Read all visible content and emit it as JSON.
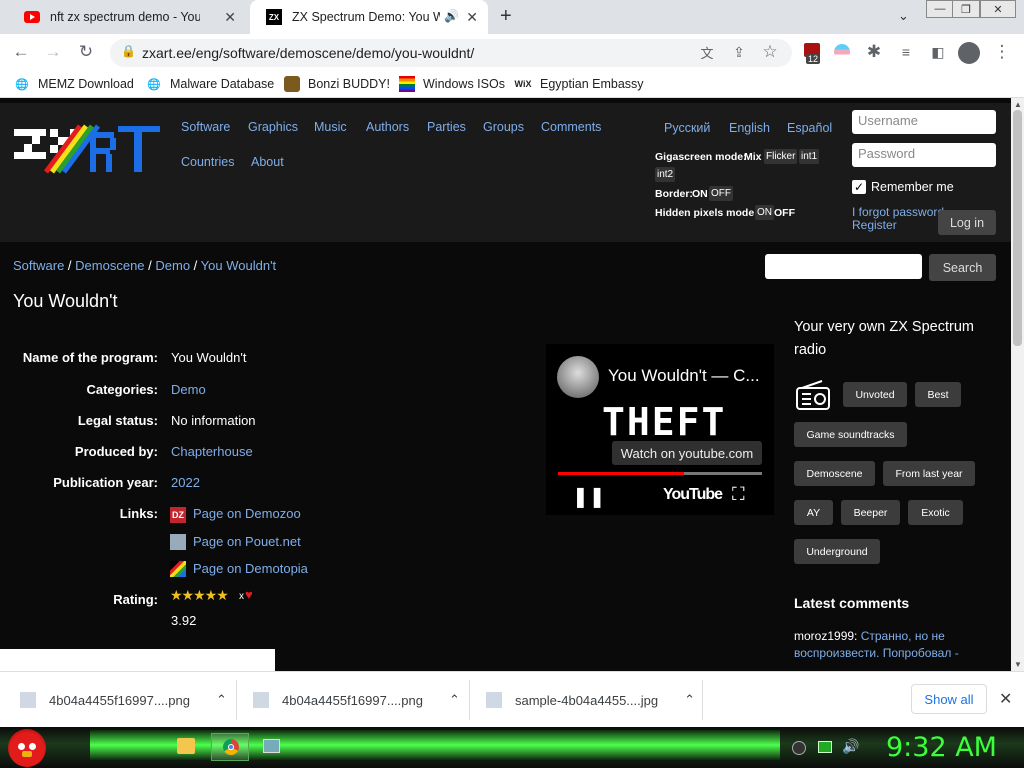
{
  "browser": {
    "tabs": [
      {
        "title": "nft zx spectrum demo - YouTube"
      },
      {
        "title": "ZX Spectrum Demo: You Wo"
      }
    ],
    "url": "zxart.ee/eng/software/demoscene/demo/you-wouldnt/",
    "ext_badge": "12",
    "bookmarks": [
      "MEMZ Download",
      "Malware Database",
      "Bonzi BUDDY!",
      "Windows ISOs",
      "Egyptian Embassy"
    ]
  },
  "site": {
    "logo": "ZXART",
    "nav": [
      "Software",
      "Graphics",
      "Music",
      "Authors",
      "Parties",
      "Groups",
      "Comments",
      "Countries",
      "About"
    ],
    "languages": [
      "Русский",
      "English",
      "Español"
    ],
    "giga_label": "Gigascreen mode:",
    "giga_opts": [
      "Mix",
      "Flicker",
      "int1",
      "int2"
    ],
    "border_label": "Border:",
    "border_opts": [
      "ON",
      "OFF"
    ],
    "hidden_label": "Hidden pixels mode:",
    "hidden_opts": [
      "ON",
      "OFF"
    ],
    "username_ph": "Username",
    "password_ph": "Password",
    "remember": "Remember me",
    "forgot": "I forgot password",
    "register": "Register",
    "login": "Log in",
    "search_btn": "Search"
  },
  "breadcrumb": [
    "Software",
    "Demoscene",
    "Demo",
    "You Wouldn't"
  ],
  "title": "You Wouldn't",
  "details": {
    "name_label": "Name of the program:",
    "name": "You Wouldn't",
    "cat_label": "Categories:",
    "cat": "Demo",
    "legal_label": "Legal status:",
    "legal": "No information",
    "prod_label": "Produced by:",
    "prod": "Chapterhouse",
    "year_label": "Publication year:",
    "year": "2022",
    "links_label": "Links:",
    "links": [
      "Page on Demozoo",
      "Page on Pouet.net",
      "Page on Demotopia"
    ],
    "rating_label": "Rating:",
    "rating": "3.92",
    "rating_x": "x"
  },
  "video": {
    "title": "You Wouldn't — C...",
    "big_text": "THEFT",
    "watch": "Watch on youtube.com",
    "brand": "YouTube",
    "progress": 0.62
  },
  "radio": {
    "title": "Your very own ZX Spectrum radio",
    "buttons": [
      "Unvoted",
      "Best",
      "Game soundtracks",
      "Demoscene",
      "From last year",
      "AY",
      "Beeper",
      "Exotic",
      "Underground"
    ]
  },
  "comments": {
    "title": "Latest comments",
    "user": "moroz1999:",
    "text": "Странно, но не воспроизвести. Попробовал - "
  },
  "downloads": {
    "files": [
      "4b04a4455f16997....png",
      "4b04a4455f16997....png",
      "sample-4b04a4455....jpg"
    ],
    "show_all": "Show all"
  },
  "taskbar": {
    "time": "9:32 AM"
  },
  "colors": {
    "link": "#7faeea",
    "page_bg": "#0a0a0a",
    "clock": "#3cff3c"
  }
}
